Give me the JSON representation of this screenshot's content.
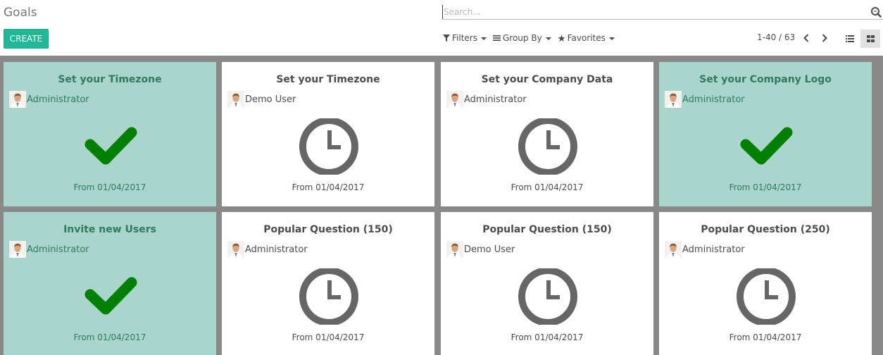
{
  "header": {
    "title": "Goals",
    "create_label": "CREATE",
    "search_placeholder": "Search...",
    "filters_label": "Filters",
    "groupby_label": "Group By",
    "favorites_label": "Favorites",
    "pager": "1-40 / 63"
  },
  "cards": [
    {
      "title": "Set your Timezone",
      "user": "Administrator",
      "from": "From 01/04/2017",
      "state": "done"
    },
    {
      "title": "Set your Timezone",
      "user": "Demo User",
      "from": "From 01/04/2017",
      "state": "pending"
    },
    {
      "title": "Set your Company Data",
      "user": "Administrator",
      "from": "From 01/04/2017",
      "state": "pending"
    },
    {
      "title": "Set your Company Logo",
      "user": "Administrator",
      "from": "From 01/04/2017",
      "state": "done"
    },
    {
      "title": "Invite new Users",
      "user": "Administrator",
      "from": "From 01/04/2017",
      "state": "done"
    },
    {
      "title": "Popular Question (150)",
      "user": "Administrator",
      "from": "From 01/04/2017",
      "state": "pending"
    },
    {
      "title": "Popular Question (150)",
      "user": "Demo User",
      "from": "From 01/04/2017",
      "state": "pending"
    },
    {
      "title": "Popular Question (250)",
      "user": "Administrator",
      "from": "From 01/04/2017",
      "state": "pending"
    }
  ],
  "colors": {
    "accent": "#21b799",
    "done_card": "#a9d5cc",
    "check": "#008000",
    "clock": "#666666"
  },
  "icons": {
    "done": "checkmark-icon",
    "pending": "clock-icon"
  }
}
